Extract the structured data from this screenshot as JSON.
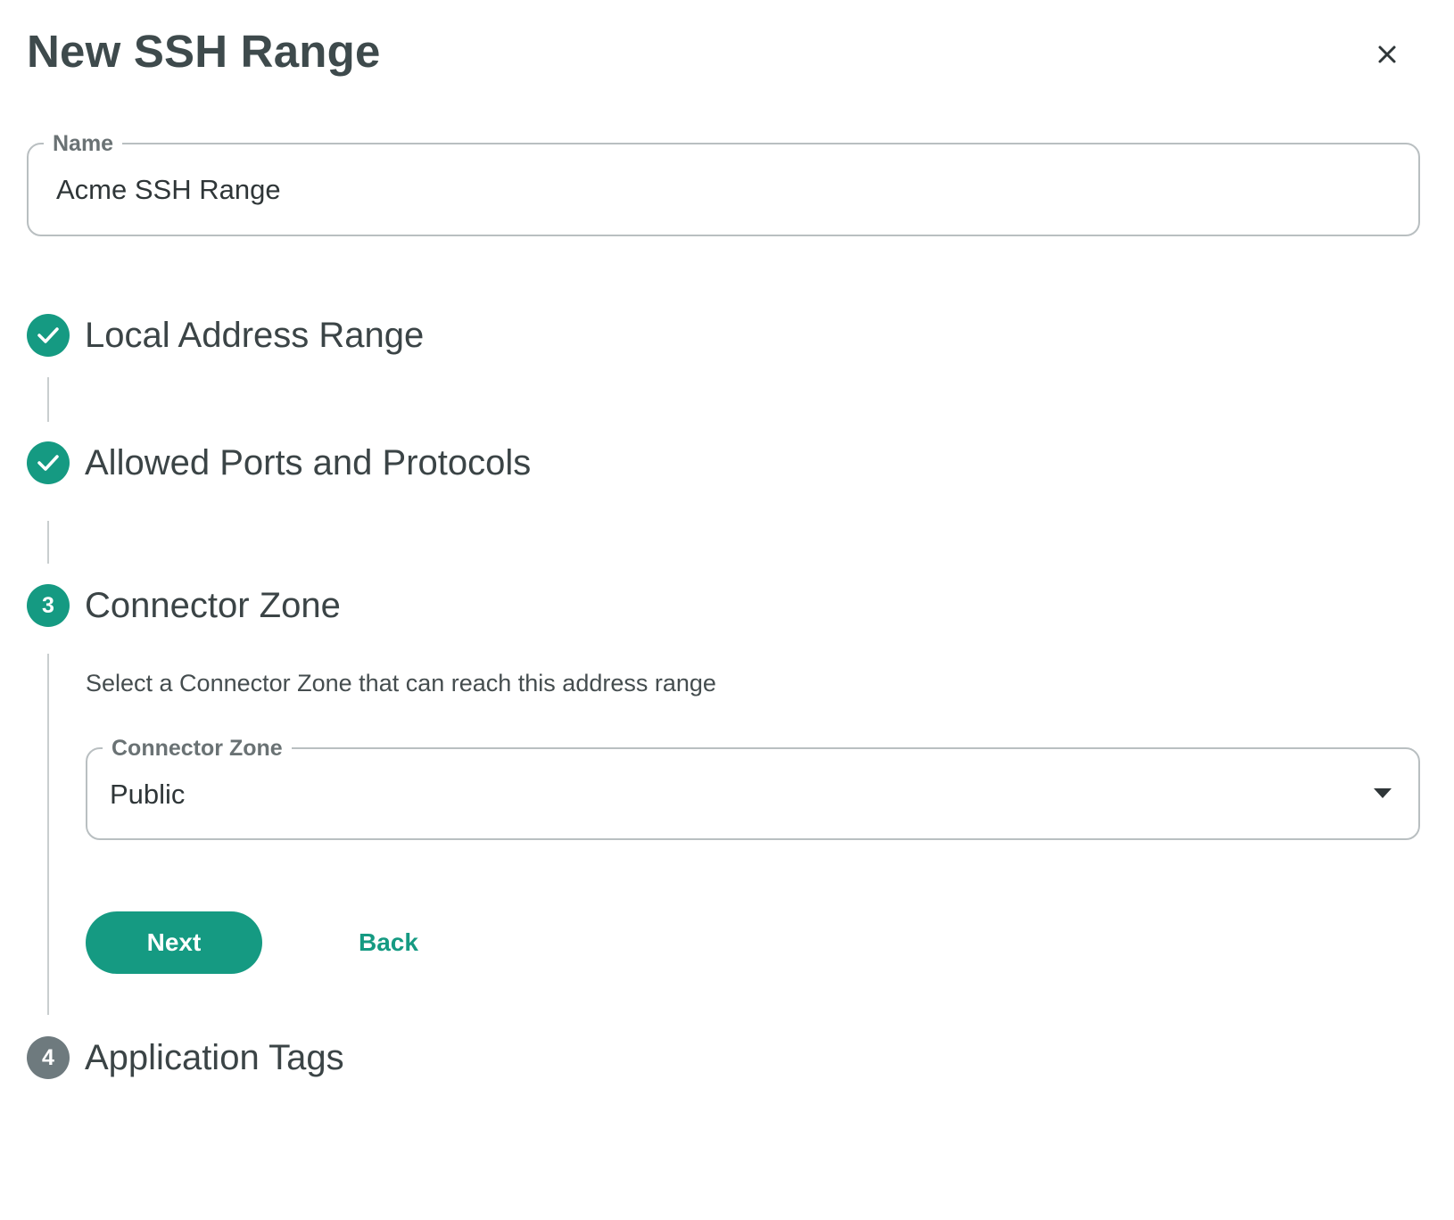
{
  "dialog": {
    "title": "New SSH Range",
    "close_icon": "close-icon"
  },
  "name_field": {
    "label": "Name",
    "value": "Acme SSH Range"
  },
  "steps": [
    {
      "status": "complete",
      "icon": "check-icon",
      "label": "Local Address Range"
    },
    {
      "status": "complete",
      "icon": "check-icon",
      "label": "Allowed Ports and Protocols"
    },
    {
      "status": "active",
      "number": "3",
      "label": "Connector Zone"
    },
    {
      "status": "pending",
      "number": "4",
      "label": "Application Tags"
    }
  ],
  "connector_zone": {
    "description": "Select a Connector Zone that can reach this address range",
    "field_label": "Connector Zone",
    "selected_value": "Public"
  },
  "actions": {
    "next_label": "Next",
    "back_label": "Back"
  },
  "colors": {
    "accent": "#159a82",
    "inactive_step": "#6e7a7e",
    "border": "#b9bfc1"
  }
}
